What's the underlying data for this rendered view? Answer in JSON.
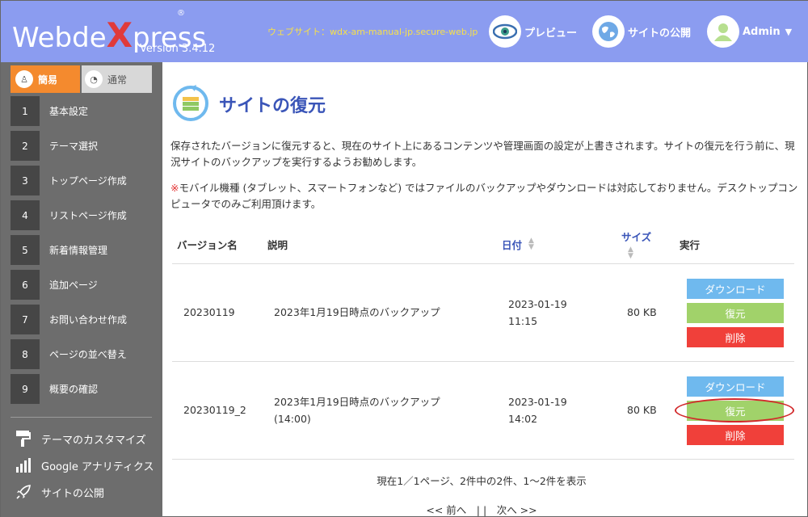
{
  "header": {
    "logo_prefix": "Webde",
    "logo_x": "X",
    "logo_suffix": "press",
    "logo_reg": "®",
    "version": "Version 3.4.12",
    "site_url": "ウェブサイト：wdx-am-manual-jp.secure-web.jp",
    "preview_label": "プレビュー",
    "publish_label": "サイトの公開",
    "admin_label": "Admin",
    "colors": {
      "bg": "#8b9cf0",
      "url": "#f7e04a"
    }
  },
  "sidebar": {
    "mode_simple": "簡易",
    "mode_normal": "通常",
    "steps": [
      {
        "num": "1",
        "label": "基本設定"
      },
      {
        "num": "2",
        "label": "テーマ選択"
      },
      {
        "num": "3",
        "label": "トップページ作成"
      },
      {
        "num": "4",
        "label": "リストページ作成"
      },
      {
        "num": "5",
        "label": "新着情報管理"
      },
      {
        "num": "6",
        "label": "追加ページ"
      },
      {
        "num": "7",
        "label": "お問い合わせ作成"
      },
      {
        "num": "8",
        "label": "ページの並べ替え"
      },
      {
        "num": "9",
        "label": "概要の確認"
      }
    ],
    "links": [
      {
        "label": "テーマのカスタマイズ",
        "icon": "paint-roller-icon"
      },
      {
        "label": "Google アナリティクス",
        "icon": "bar-chart-icon"
      },
      {
        "label": "サイトの公開",
        "icon": "rocket-icon"
      }
    ]
  },
  "main": {
    "title": "サイトの復元",
    "description": "保存されたバージョンに復元すると、現在のサイト上にあるコンテンツや管理画面の設定が上書きされます。サイトの復元を行う前に、現況サイトのバックアップを実行するようお勧めします。",
    "note_mark": "※",
    "note": "モバイル機種 (タブレット、スマートフォンなど) ではファイルのバックアップやダウンロードは対応しておりません。デスクトップコンピュータでのみご利用頂けます。",
    "table": {
      "headers": {
        "version": "バージョン名",
        "desc": "説明",
        "date": "日付",
        "size": "サイズ",
        "action": "実行"
      },
      "rows": [
        {
          "version": "20230119",
          "desc": "2023年1月19日時点のバックアップ",
          "date": "2023-01-19",
          "time": "11:15",
          "size": "80 KB"
        },
        {
          "version": "20230119_2",
          "desc": "2023年1月19日時点のバックアップ",
          "desc2": "(14:00)",
          "date": "2023-01-19",
          "time": "14:02",
          "size": "80 KB"
        }
      ],
      "buttons": {
        "download": "ダウンロード",
        "restore": "復元",
        "delete": "削除"
      }
    },
    "pager_info": "現在1／1ページ、2件中の2件、1～2件を表示",
    "pager": "<< 前へ　| |　次へ >>"
  }
}
